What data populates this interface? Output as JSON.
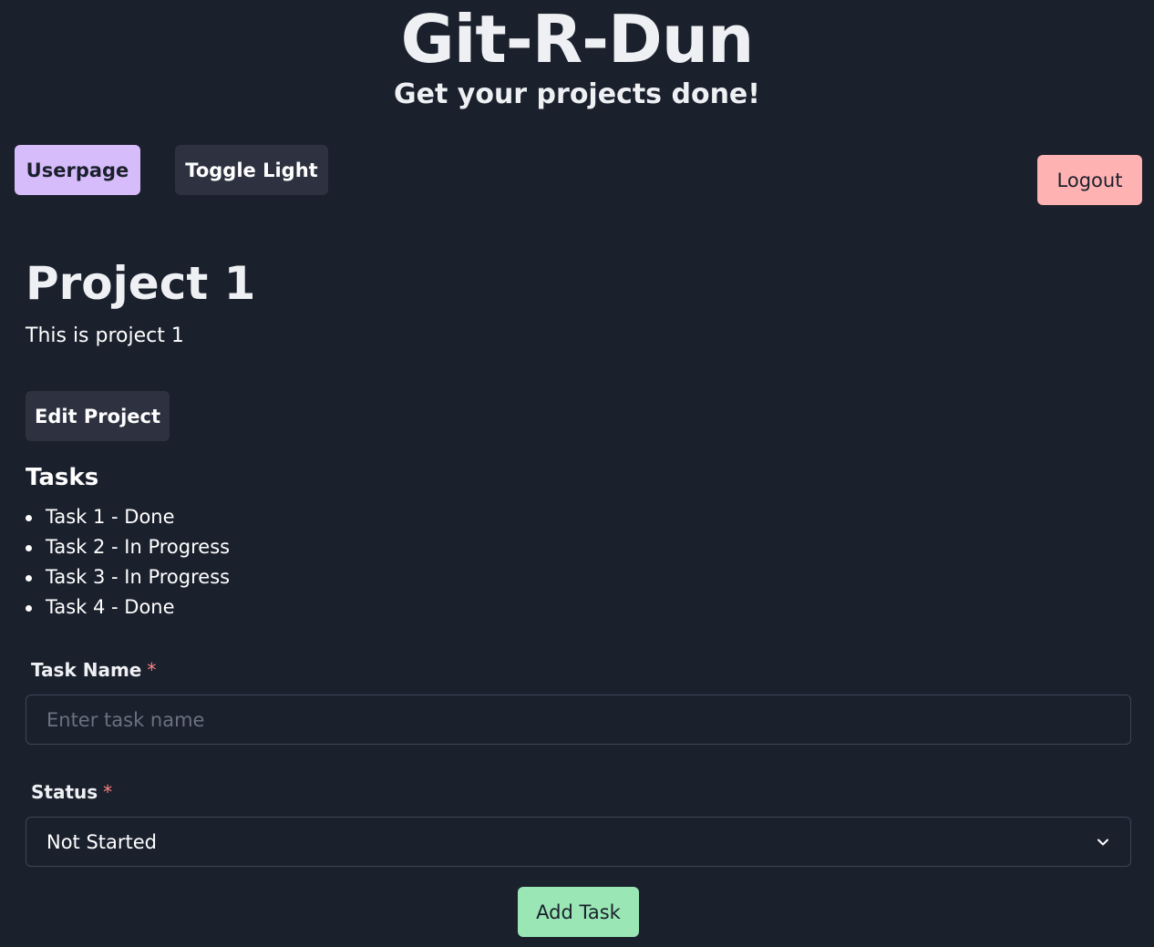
{
  "header": {
    "title": "Git-R-Dun",
    "subtitle": "Get your projects done!"
  },
  "nav": {
    "userpage_label": "Userpage",
    "toggle_label": "Toggle Light",
    "logout_label": "Logout"
  },
  "project": {
    "title": "Project 1",
    "description": "This is project 1",
    "edit_label": "Edit Project"
  },
  "tasks": {
    "heading": "Tasks",
    "items": [
      "Task 1 - Done",
      "Task 2 - In Progress",
      "Task 3 - In Progress",
      "Task 4 - Done"
    ]
  },
  "form": {
    "task_name_label": "Task Name",
    "task_name_placeholder": "Enter task name",
    "required_marker": "*",
    "status_label": "Status",
    "status_value": "Not Started",
    "submit_label": "Add Task"
  },
  "colors": {
    "background": "#1b202d",
    "userpage_button": "#d6bcfa",
    "logout_button": "#feb2b2",
    "add_button": "#9ae6b4",
    "required_marker": "#fc8181"
  },
  "icons": {
    "status_dropdown": "chevron-down-icon"
  }
}
